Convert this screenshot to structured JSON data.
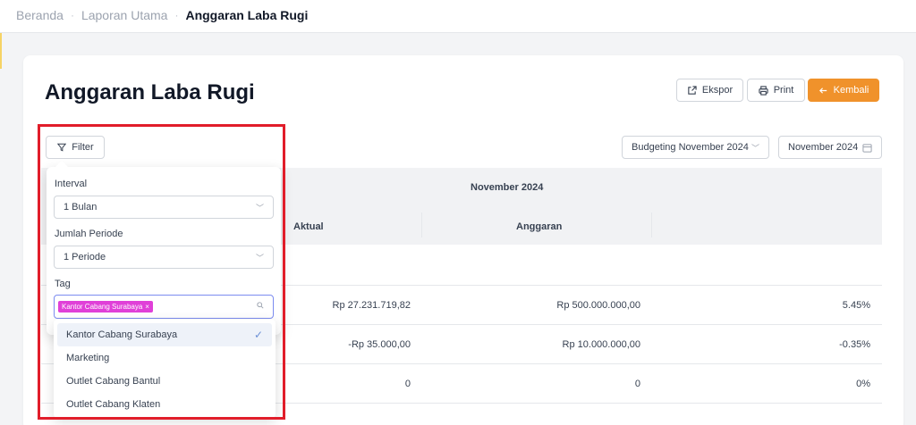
{
  "breadcrumb": {
    "home": "Beranda",
    "parent": "Laporan Utama",
    "current": "Anggaran Laba Rugi",
    "separator": "·"
  },
  "page": {
    "title": "Anggaran Laba Rugi"
  },
  "toolbar": {
    "export_label": "Ekspor",
    "print_label": "Print",
    "back_label": "Kembali"
  },
  "filter": {
    "label": "Filter"
  },
  "selectors": {
    "budget": "Budgeting November 2024",
    "month": "November 2024"
  },
  "table": {
    "period": "November 2024",
    "col_actual": "Aktual",
    "col_budget": "Anggaran",
    "rows": [
      {
        "actual": "Rp 27.231.719,82",
        "budget": "Rp 500.000.000,00",
        "percent": "5.45%"
      },
      {
        "actual": "-Rp 35.000,00",
        "budget": "Rp 10.000.000,00",
        "percent": "-0.35%"
      },
      {
        "actual": "0",
        "budget": "0",
        "percent": "0%"
      }
    ]
  },
  "filter_panel": {
    "interval_label": "Interval",
    "interval_value": "1 Bulan",
    "periods_label": "Jumlah Periode",
    "periods_value": "1 Periode",
    "tag_label": "Tag",
    "tag_chip": "Kantor Cabang Surabaya",
    "tag_chip_remove": "×",
    "options": [
      "Kantor Cabang Surabaya",
      "Marketing",
      "Outlet Cabang Bantul",
      "Outlet Cabang Klaten"
    ]
  },
  "colors": {
    "accent": "#f0922b",
    "chip": "#e040d8",
    "highlight": "#e11d2a"
  }
}
